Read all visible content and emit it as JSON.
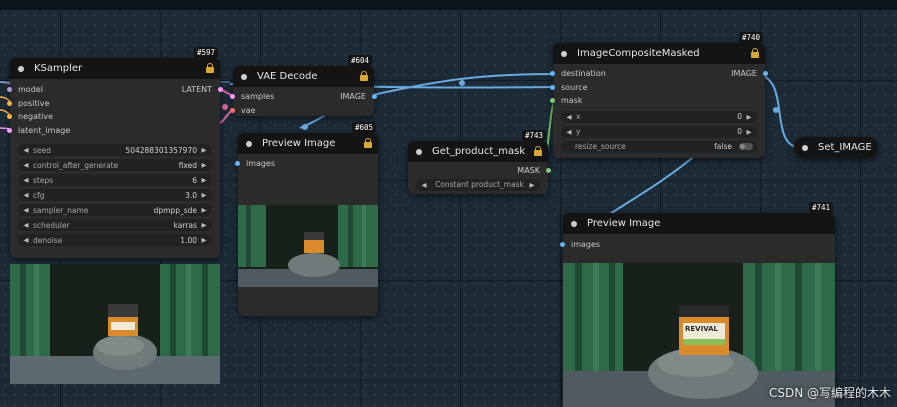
{
  "colors": {
    "canvas": "#1d2b37",
    "link_blue": "#6aa9e0",
    "link_pink": "#e06aa0",
    "link_green": "#7ac86a",
    "slot_model": "#b39ddb",
    "slot_conditioning": "#ffb347",
    "slot_latent": "#ff9cf9",
    "slot_image": "#64b5f6",
    "slot_vae": "#ff6e6e",
    "slot_mask": "#81c784",
    "lock": "#d9a934"
  },
  "ksampler": {
    "id": "#597",
    "title": "KSampler",
    "inputs": [
      "model",
      "positive",
      "negative",
      "latent_image"
    ],
    "output": "LATENT",
    "widgets": [
      {
        "name": "seed",
        "value": "504288301357970"
      },
      {
        "name": "control_after_generate",
        "value": "fixed"
      },
      {
        "name": "steps",
        "value": "6"
      },
      {
        "name": "cfg",
        "value": "3.0"
      },
      {
        "name": "sampler_name",
        "value": "dpmpp_sde"
      },
      {
        "name": "scheduler",
        "value": "karras"
      },
      {
        "name": "denoise",
        "value": "1.00"
      }
    ]
  },
  "vae_decode": {
    "id": "#604",
    "title": "VAE Decode",
    "inputs": [
      "samples",
      "vae"
    ],
    "output": "IMAGE"
  },
  "preview_605": {
    "id": "#605",
    "title": "Preview Image",
    "input": "images"
  },
  "get_mask": {
    "id": "#743",
    "title": "Get_product_mask",
    "output": "MASK",
    "widget": "Constant product_mask"
  },
  "composite": {
    "id": "#740",
    "title": "ImageCompositeMasked",
    "inputs": [
      "destination",
      "source",
      "mask"
    ],
    "output": "IMAGE",
    "widgets": [
      {
        "name": "x",
        "value": "0"
      },
      {
        "name": "y",
        "value": "0"
      }
    ],
    "toggle": {
      "name": "resize_source",
      "value": "false"
    }
  },
  "set_image": {
    "title": "Set_IMAGE"
  },
  "preview_741": {
    "id": "#741",
    "title": "Preview Image",
    "input": "images",
    "jar_label": "REVIVAL"
  },
  "ksampler_preview": {
    "jar_label": "ASIATIAS"
  },
  "watermark": "CSDN @写编程的木木"
}
